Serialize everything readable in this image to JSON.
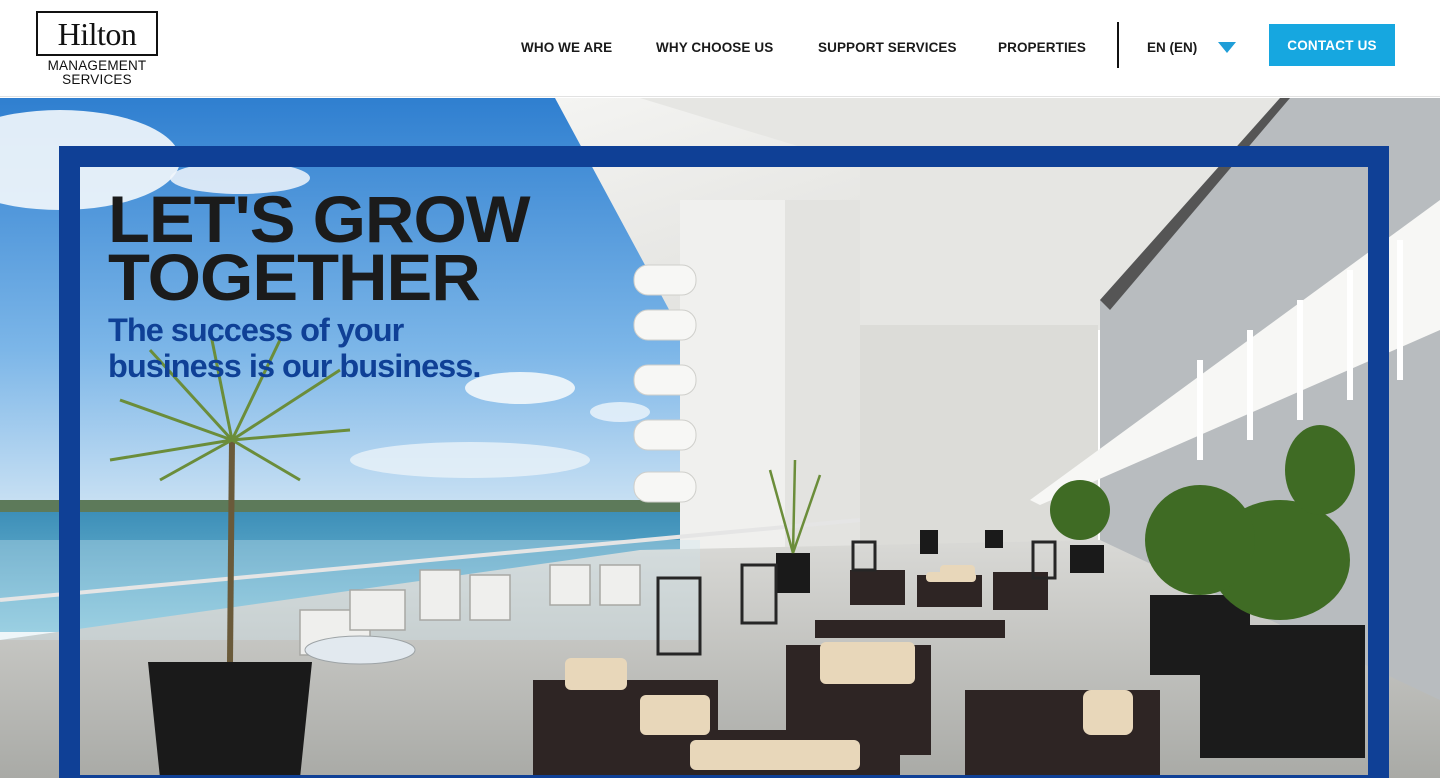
{
  "brand": {
    "name": "Hilton",
    "sub_line1": "MANAGEMENT",
    "sub_line2": "SERVICES"
  },
  "nav": {
    "items": [
      {
        "label": "WHO WE ARE"
      },
      {
        "label": "WHY CHOOSE US"
      },
      {
        "label": "SUPPORT SERVICES"
      },
      {
        "label": "PROPERTIES"
      }
    ],
    "language": "EN (EN)",
    "contact_label": "CONTACT US"
  },
  "hero": {
    "headline_line1": "LET'S GROW",
    "headline_line2": "TOGETHER",
    "tagline_line1": "The success of your",
    "tagline_line2": "business is our business."
  },
  "colors": {
    "accent_blue": "#0f4096",
    "button_blue": "#16a7e0",
    "caret_blue": "#1f9ed8"
  },
  "icons": {
    "language_toggle": "chevron-down-icon"
  }
}
